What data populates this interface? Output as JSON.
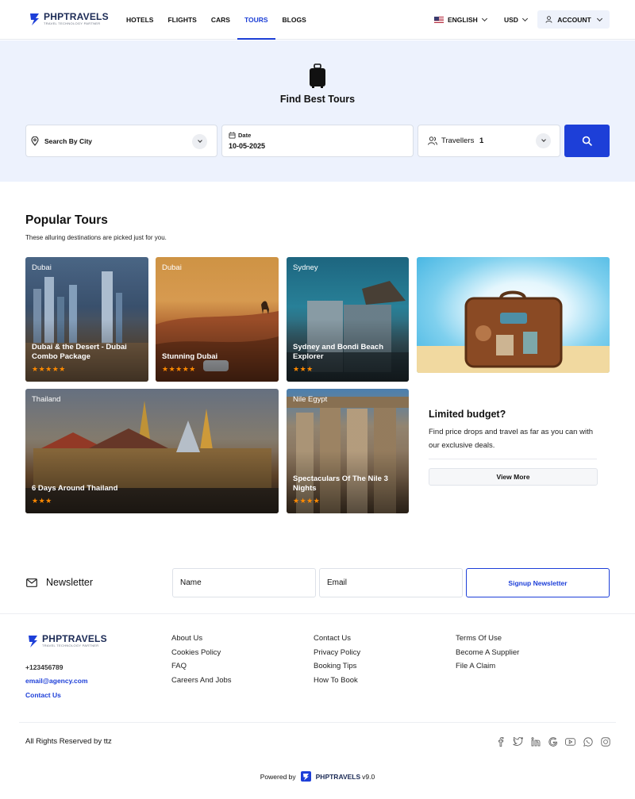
{
  "brand": {
    "name": "PHPTRAVELS",
    "tagline": "TRAVEL TECHNOLOGY PARTNER",
    "color": "#1d3fd8"
  },
  "nav": {
    "items": [
      "HOTELS",
      "FLIGHTS",
      "CARS",
      "TOURS",
      "BLOGS"
    ],
    "active": "TOURS"
  },
  "header": {
    "language": "ENGLISH",
    "currency": "USD",
    "account": "ACCOUNT"
  },
  "hero": {
    "title": "Find Best Tours",
    "icon": "suitcase-icon"
  },
  "search": {
    "city_placeholder": "Search By City",
    "date_label": "Date",
    "date_value": "10-05-2025",
    "travellers_label": "Travellers",
    "travellers_value": "1"
  },
  "popular": {
    "title": "Popular Tours",
    "subtitle": "These alluring destinations are picked just for you.",
    "tours": [
      {
        "location": "Dubai",
        "title": "Dubai & the Desert - Dubai Combo Package",
        "stars": "★★★★★"
      },
      {
        "location": "Dubai",
        "title": "Stunning Dubai",
        "stars": "★★★★★"
      },
      {
        "location": "Sydney",
        "title": "Sydney and Bondi Beach Explorer",
        "stars": "★★★"
      },
      {
        "location": "Thailand",
        "title": "6 Days Around Thailand",
        "stars": "★★★"
      },
      {
        "location": "Nile Egypt",
        "title": "Spectaculars Of The Nile 3 Nights",
        "stars": "★★★★"
      }
    ]
  },
  "promo": {
    "title": "Limited budget?",
    "text": "Find price drops and travel as far as you can with our exclusive deals.",
    "button": "View More"
  },
  "newsletter": {
    "label": "Newsletter",
    "name_placeholder": "Name",
    "email_placeholder": "Email",
    "button": "Signup Newsletter"
  },
  "footer": {
    "phone": "+123456789",
    "email": "email@agency.com",
    "contact_link": "Contact Us",
    "col1": [
      "About Us",
      "Cookies Policy",
      "FAQ",
      "Careers And Jobs"
    ],
    "col2": [
      "Contact Us",
      "Privacy Policy",
      "Booking Tips",
      "How To Book"
    ],
    "col3": [
      "Terms Of Use",
      "Become A Supplier",
      "File A Claim"
    ],
    "copyright": "All Rights Reserved by ttz",
    "social": [
      "facebook-icon",
      "twitter-icon",
      "linkedin-icon",
      "google-icon",
      "youtube-icon",
      "whatsapp-icon",
      "instagram-icon"
    ],
    "powered_by": "Powered by",
    "powered_brand": "PHPTRAVELS",
    "version": "v9.0"
  }
}
